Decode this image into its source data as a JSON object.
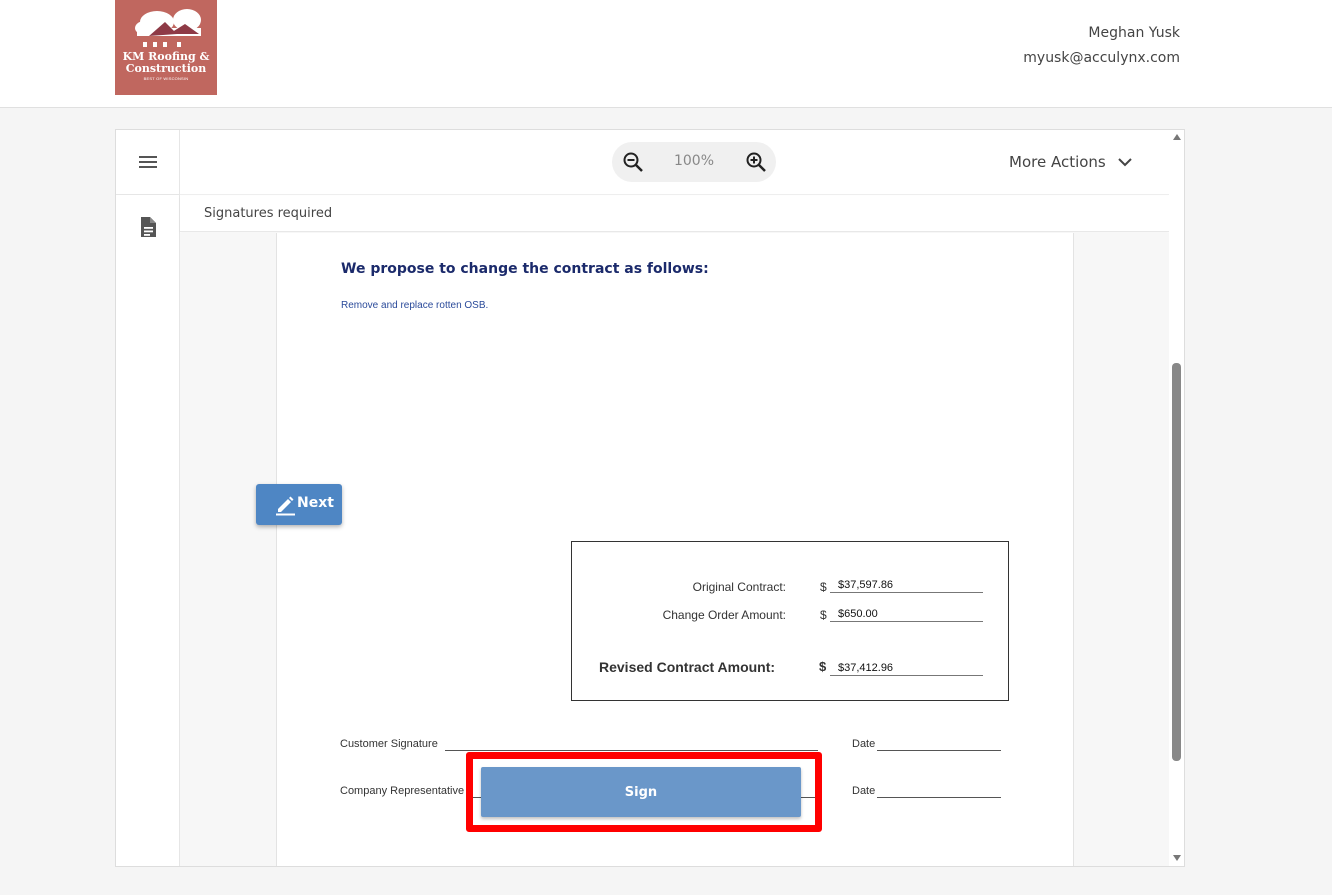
{
  "header": {
    "logo": {
      "line1": "KM Roofing &",
      "line2": "Construction",
      "tagline": "BEST OF WISCONSIN",
      "bg_color": "#c0675f"
    },
    "user_name": "Meghan Yusk",
    "user_email": "myusk@acculynx.com"
  },
  "rail": {
    "menu_icon": "hamburger-menu-icon",
    "document_icon": "document-icon"
  },
  "toolbar": {
    "zoom_level": "100%",
    "zoom_out_icon": "zoom-out-icon",
    "zoom_in_icon": "zoom-in-icon",
    "more_actions_label": "More Actions"
  },
  "signature_bar": {
    "label": "Signatures required"
  },
  "document": {
    "title": "We propose to change the contract as follows:",
    "body": "Remove and replace rotten OSB.",
    "totals": {
      "original_label": "Original Contract:",
      "original_currency": "$",
      "original_value": "$37,597.86",
      "change_label": "Change Order Amount:",
      "change_currency": "$",
      "change_value": "$650.00",
      "revised_label": "Revised Contract Amount:",
      "revised_currency": "$",
      "revised_value": "$37,412.96"
    },
    "customer_signature_label": "Customer Signature",
    "company_rep_label": "Company Representative",
    "date_label": "Date"
  },
  "actions": {
    "next_label": "Next",
    "sign_label": "Sign"
  },
  "colors": {
    "accent": "#4e86c4",
    "sign_button": "#6a97c9",
    "highlight": "#ff0000",
    "title_text": "#1b2a6b"
  }
}
